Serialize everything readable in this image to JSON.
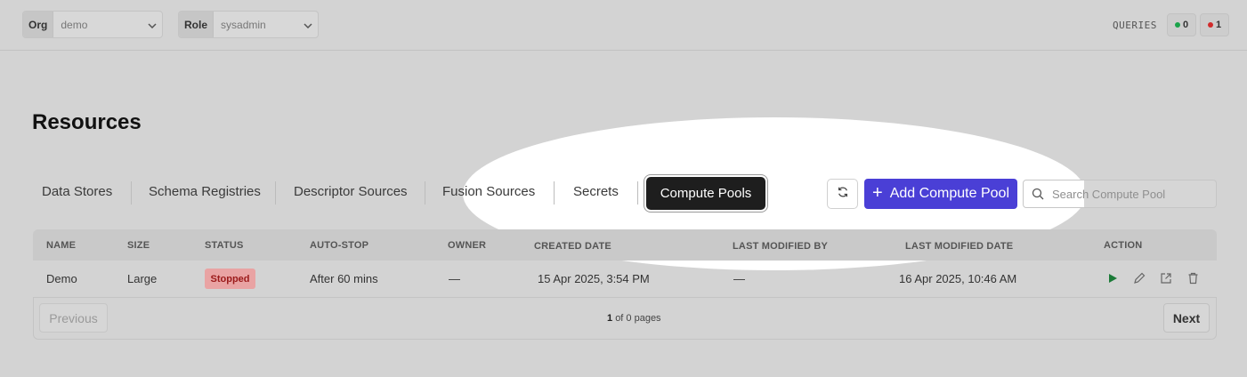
{
  "topbar": {
    "org": {
      "label": "Org",
      "value": "demo"
    },
    "role": {
      "label": "Role",
      "value": "sysadmin"
    },
    "queries_label": "QUERIES",
    "queries_ok": "0",
    "queries_err": "1",
    "ok_color": "#1aa34a",
    "err_color": "#d12b2b"
  },
  "page": {
    "title": "Resources"
  },
  "tabs": [
    {
      "label": "Data Stores"
    },
    {
      "label": "Schema Registries"
    },
    {
      "label": "Descriptor Sources"
    },
    {
      "label": "Fusion Sources"
    },
    {
      "label": "Secrets"
    },
    {
      "label": "Compute Pools"
    }
  ],
  "toolbar": {
    "add_label": "Add Compute Pool",
    "search_placeholder": "Search Compute Pool",
    "accent_color": "#4a3fd6"
  },
  "table": {
    "headers": [
      "NAME",
      "SIZE",
      "STATUS",
      "AUTO-STOP",
      "OWNER",
      "CREATED DATE",
      "LAST MODIFIED BY",
      "LAST MODIFIED DATE",
      "ACTION"
    ],
    "rows": [
      {
        "name": "Demo",
        "size": "Large",
        "status": "Stopped",
        "auto_stop": "After 60 mins",
        "owner": "—",
        "created": "15 Apr 2025, 3:54 PM",
        "modified_by": "—",
        "modified_date": "16 Apr 2025, 10:46 AM"
      }
    ]
  },
  "pagination": {
    "previous": "Previous",
    "next": "Next",
    "current": "1",
    "of_text": "of 0 pages"
  }
}
